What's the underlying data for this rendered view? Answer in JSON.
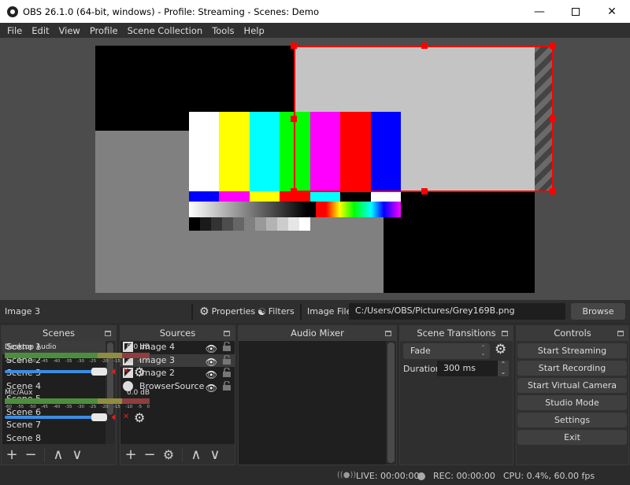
{
  "window": {
    "title": "OBS 26.1.0 (64-bit, windows) - Profile: Streaming - Scenes: Demo",
    "minimize_icon": "minimize-icon",
    "maximize_icon": "maximize-icon",
    "close_icon": "close-icon"
  },
  "menu": [
    "File",
    "Edit",
    "View",
    "Profile",
    "Scene Collection",
    "Tools",
    "Help"
  ],
  "preview": {
    "selection_color": "#ff0000",
    "color_bars_top": [
      "#ffffff",
      "#ffff00",
      "#00ffff",
      "#00ff00",
      "#ff00ff",
      "#ff0000",
      "#0000ff"
    ],
    "color_bars_mid": [
      "#0000ff",
      "#ff00ff",
      "#ffff00",
      "#ff0000",
      "#00ffff",
      "#000000",
      "#ffffff"
    ],
    "gray_steps": [
      "#000000",
      "#1a1a1a",
      "#333333",
      "#4d4d4d",
      "#666666",
      "#808080",
      "#999999",
      "#b3b3b3",
      "#cccccc",
      "#e6e6e6",
      "#ffffff"
    ]
  },
  "context_bar": {
    "selected_source": "Image 3",
    "properties_label": "Properties",
    "filters_label": "Filters",
    "image_file_label": "Image File",
    "image_file_path": "C:/Users/OBS/Pictures/Grey169B.png",
    "browse_label": "Browse"
  },
  "scenes": {
    "title": "Scenes",
    "items": [
      "Scene 1",
      "Scene 2",
      "Scene 3",
      "Scene 4",
      "Scene 5",
      "Scene 6",
      "Scene 7",
      "Scene 8"
    ],
    "selected": "Scene 1",
    "toolbar": {
      "add": "+",
      "remove": "−",
      "up": "∧",
      "down": "∨"
    }
  },
  "sources": {
    "title": "Sources",
    "items": [
      {
        "name": "Image 4",
        "type": "image",
        "visible": true,
        "locked": false
      },
      {
        "name": "Image 3",
        "type": "image",
        "visible": true,
        "locked": false
      },
      {
        "name": "Image 2",
        "type": "image",
        "visible": true,
        "locked": false
      },
      {
        "name": "BrowserSource",
        "type": "browser",
        "visible": true,
        "locked": false
      }
    ],
    "selected": "Image 3",
    "toolbar": {
      "add": "+",
      "remove": "−",
      "settings": "⚙",
      "up": "∧",
      "down": "∨"
    }
  },
  "audio_mixer": {
    "title": "Audio Mixer",
    "channels": [
      {
        "name": "Desktop Audio",
        "level": "0.0 dB",
        "volume": 1.0,
        "muted": true
      },
      {
        "name": "Mic/Aux",
        "level": "0.0 dB",
        "volume": 1.0,
        "muted": true
      }
    ],
    "ticks": [
      "-60",
      "-55",
      "-50",
      "-45",
      "-40",
      "-35",
      "-30",
      "-25",
      "-20",
      "-15",
      "-10",
      "-5",
      "0"
    ],
    "meter_colors": {
      "green": "#4a9a3a",
      "yellow": "#9a9a3a",
      "red": "#9a3a3a"
    }
  },
  "transitions": {
    "title": "Scene Transitions",
    "selected": "Fade",
    "duration_label": "Duration",
    "duration_value": "300 ms"
  },
  "controls": {
    "title": "Controls",
    "buttons": [
      "Start Streaming",
      "Start Recording",
      "Start Virtual Camera",
      "Studio Mode",
      "Settings",
      "Exit"
    ]
  },
  "status": {
    "live": "LIVE: 00:00:00",
    "rec": "REC: 00:00:00",
    "cpu": "CPU: 0.4%, 60.00 fps"
  }
}
